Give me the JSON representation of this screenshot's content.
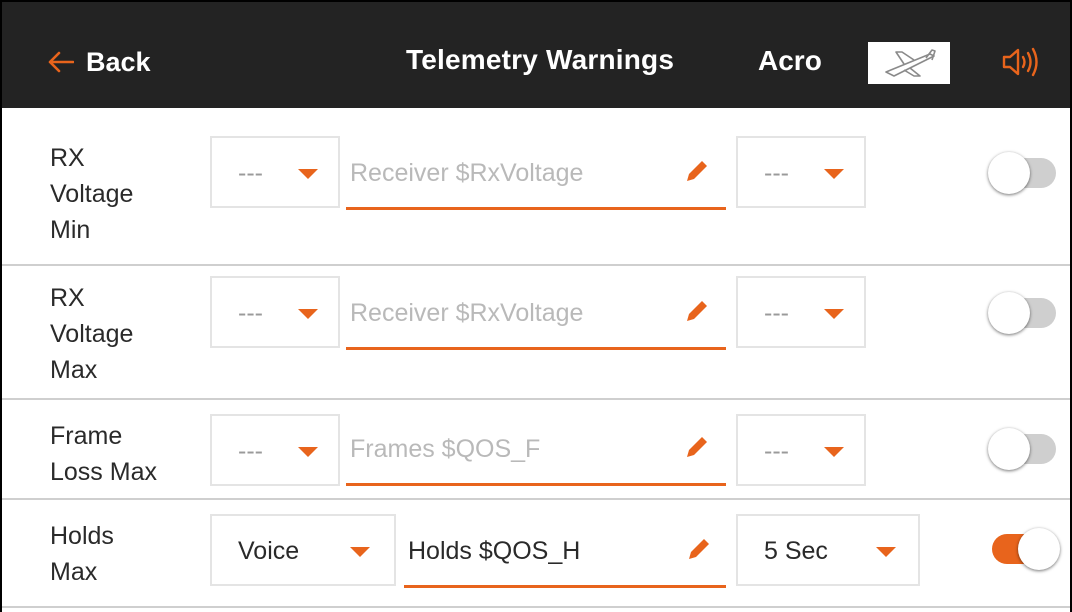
{
  "header": {
    "back_label": "Back",
    "title": "Telemetry Warnings",
    "model_name": "Acro",
    "model_icon": "airplane-icon",
    "speaker_icon": "speaker-icon"
  },
  "colors": {
    "accent": "#e8641c",
    "header_bg": "#232323",
    "toggle_off": "#cfcfcf"
  },
  "rows": [
    {
      "label": "RX\nVoltage\nMin",
      "alert_type": "---",
      "text": "Receiver $RxVoltage",
      "repeat": "---",
      "enabled": false
    },
    {
      "label": "RX\nVoltage\nMax",
      "alert_type": "---",
      "text": "Receiver $RxVoltage",
      "repeat": "---",
      "enabled": false
    },
    {
      "label": "Frame\nLoss Max",
      "alert_type": "---",
      "text": "Frames $QOS_F",
      "repeat": "---",
      "enabled": false
    },
    {
      "label": "Holds\nMax",
      "alert_type": "Voice",
      "text": "Holds $QOS_H",
      "repeat": "5 Sec",
      "enabled": true
    }
  ]
}
